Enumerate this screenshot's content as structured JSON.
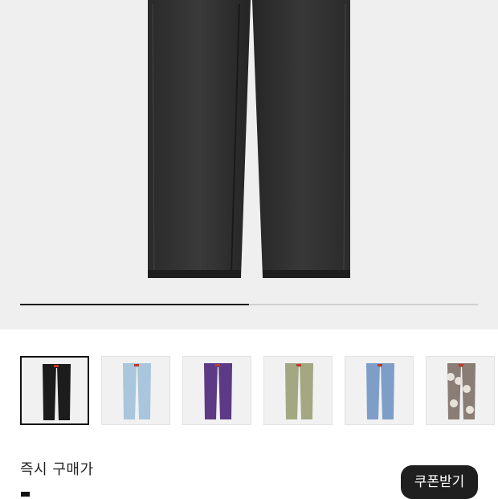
{
  "product_gallery": {
    "progress": 0.5,
    "thumbnails": [
      {
        "variant": "black",
        "color": "#1c1c1c",
        "selected": true
      },
      {
        "variant": "light-blue",
        "color": "#a9c6dc",
        "selected": false
      },
      {
        "variant": "purple",
        "color": "#5d3a86",
        "selected": false
      },
      {
        "variant": "olive",
        "color": "#a3a882",
        "selected": false
      },
      {
        "variant": "blue",
        "color": "#7e9ec8",
        "selected": false
      },
      {
        "variant": "pattern",
        "color": "#8a7d76",
        "selected": false
      }
    ]
  },
  "purchase": {
    "label": "즉시 구매가",
    "coupon_button": "쿠폰받기"
  },
  "colors": {
    "accent": "#111111",
    "hero_background": "#efefef"
  }
}
